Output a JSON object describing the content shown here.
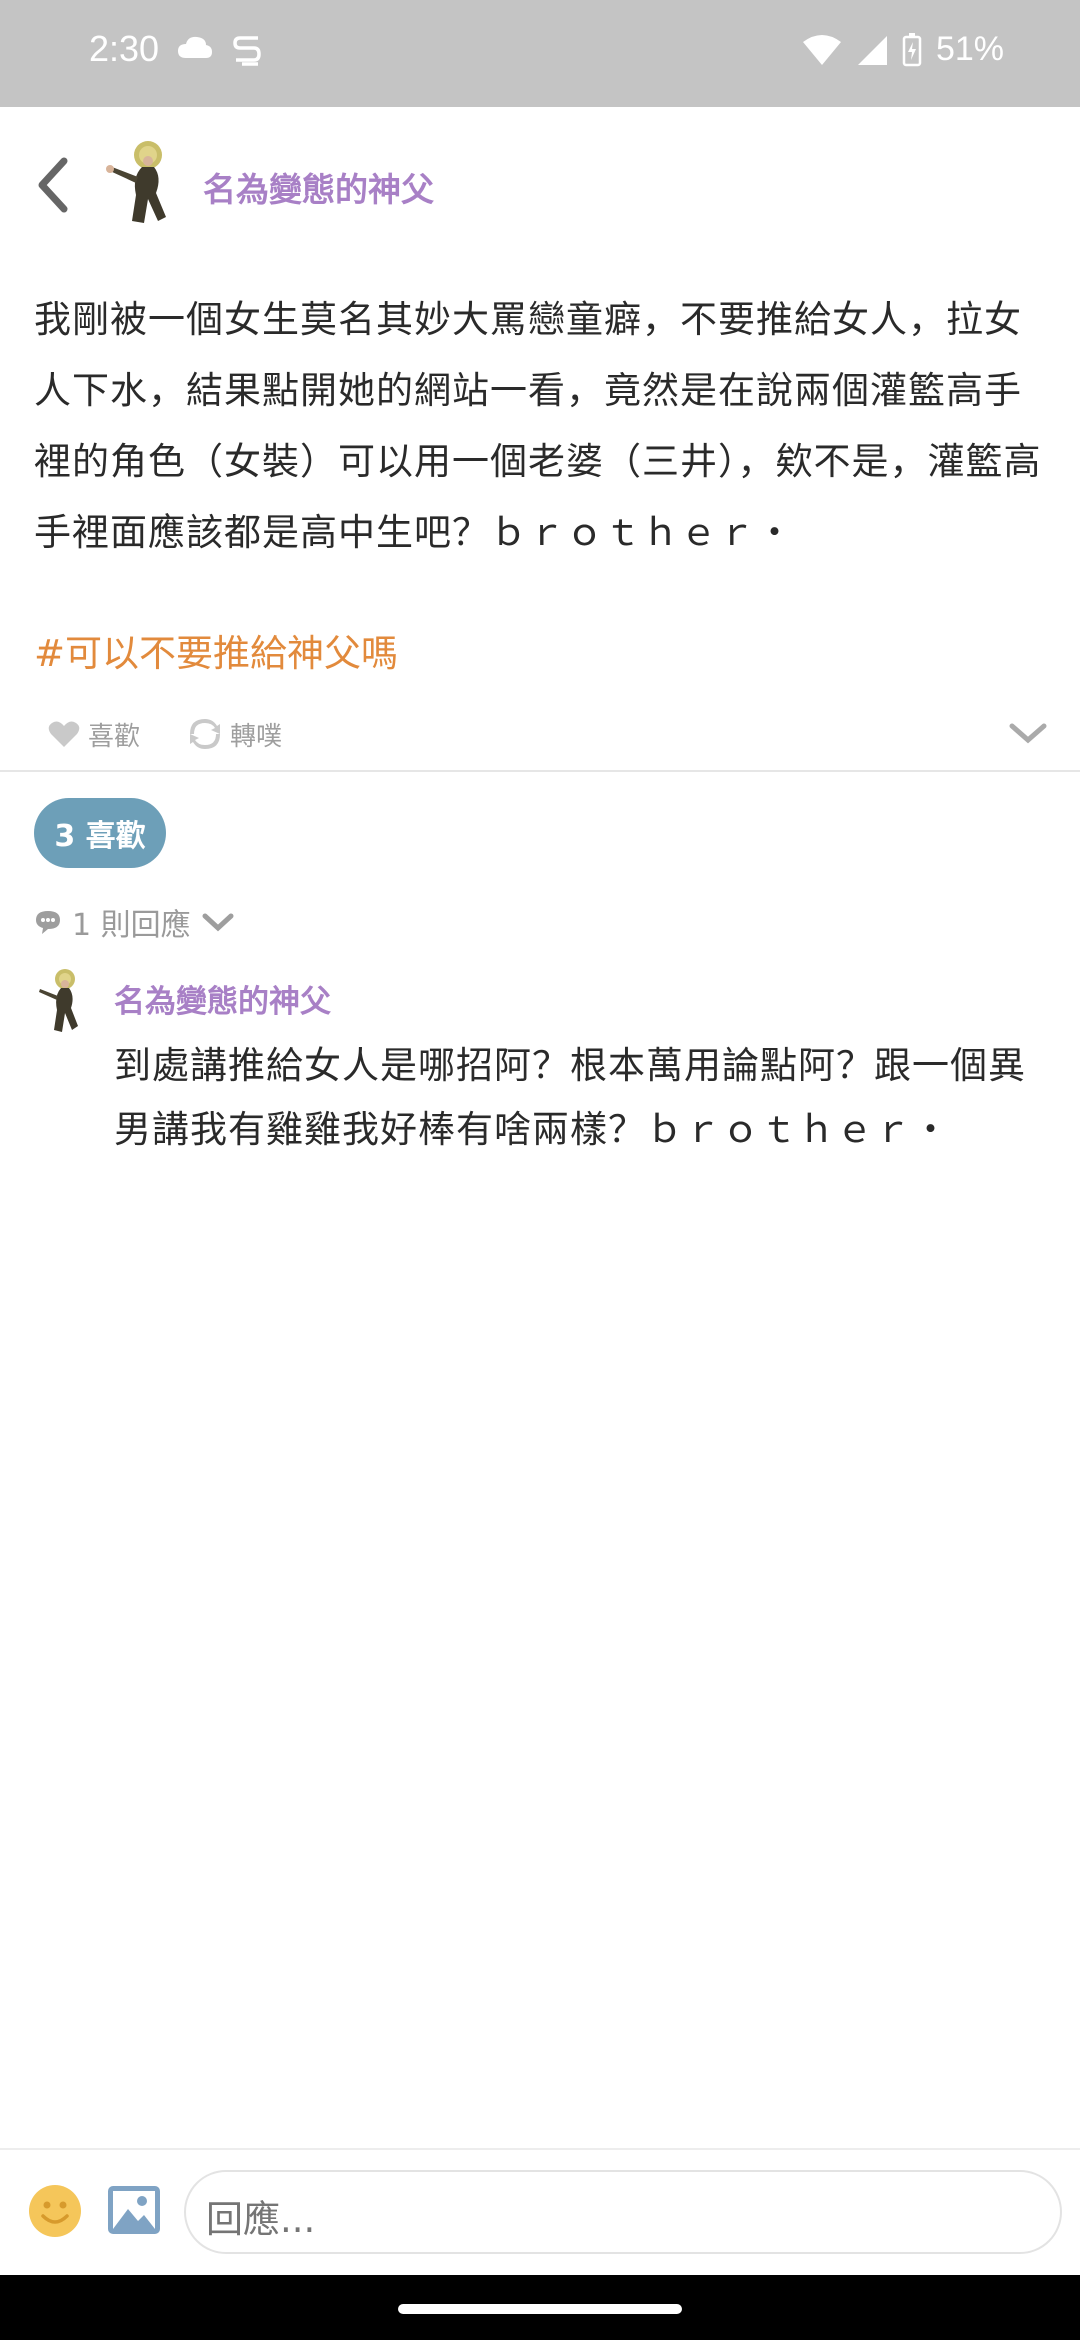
{
  "status_bar": {
    "time": "2:30",
    "battery": "51%"
  },
  "header": {
    "author": "名為變態的神父"
  },
  "post": {
    "body": "我剛被一個女生莫名其妙大罵戀童癖，不要推給女人，拉女人下水，結果點開她的網站一看，竟然是在說兩個灌籃高手裡的角色（女裝）可以用一個老婆（三井），欸不是，灌籃高手裡面應該都是高中生吧？ｂｒｏｔｈｅｒ・",
    "hashtag": "#可以不要推給神父嗎",
    "actions": {
      "like_label": "喜歡",
      "replurk_label": "轉噗"
    },
    "likes_badge": "3 喜歡",
    "replies_count": "1 則回應"
  },
  "reply": {
    "author": "名為變態的神父",
    "body": "到處講推給女人是哪招阿？根本萬用論點阿？跟一個異男講我有雞雞我好棒有啥兩樣？ｂｒｏｔｈｅｒ・"
  },
  "composer": {
    "placeholder": "回應..."
  },
  "colors": {
    "author": "#a880c6",
    "hashtag": "#e28a3c",
    "likes_badge": "#6d9fb8",
    "status_bar": "#c4c4c4"
  },
  "icons": [
    "cloud-icon",
    "s-app-icon",
    "wifi-icon",
    "signal-icon",
    "battery-charging-icon",
    "back-icon",
    "heart-icon",
    "replurk-icon",
    "chevron-down-icon",
    "comment-icon",
    "emoji-icon",
    "image-icon"
  ]
}
